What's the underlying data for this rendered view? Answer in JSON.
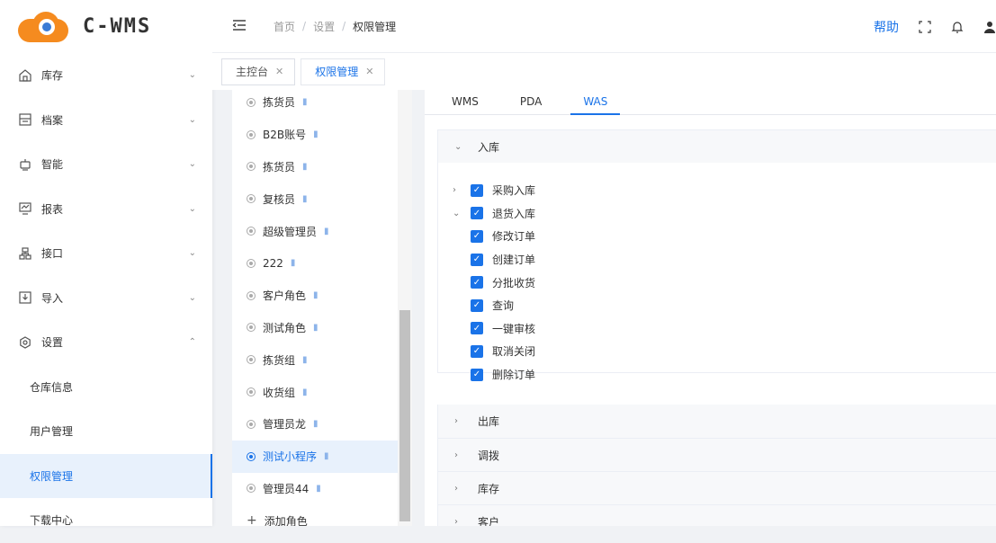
{
  "brand": {
    "logo_text": "C-WMS"
  },
  "sidebar": {
    "menu": [
      {
        "label": "库存",
        "icon": "home-icon",
        "arrow": "⌄"
      },
      {
        "label": "档案",
        "icon": "archive-icon",
        "arrow": "⌄"
      },
      {
        "label": "智能",
        "icon": "robot-icon",
        "arrow": "⌄"
      },
      {
        "label": "报表",
        "icon": "chart-icon",
        "arrow": "⌄"
      },
      {
        "label": "接口",
        "icon": "network-icon",
        "arrow": "⌄"
      },
      {
        "label": "导入",
        "icon": "import-icon",
        "arrow": "⌄"
      },
      {
        "label": "设置",
        "icon": "gear-icon",
        "arrow": "⌃"
      }
    ],
    "sub": [
      {
        "label": "仓库信息"
      },
      {
        "label": "用户管理"
      },
      {
        "label": "权限管理"
      },
      {
        "label": "下载中心"
      }
    ]
  },
  "header": {
    "breadcrumb": [
      "首页",
      "设置",
      "权限管理"
    ],
    "separator": "/",
    "help": "帮助",
    "accent": "#1a73e8"
  },
  "tags": [
    {
      "label": "主控台",
      "close": "✕"
    },
    {
      "label": "权限管理",
      "close": "✕"
    }
  ],
  "roles": {
    "items": [
      "拣货员",
      "B2B账号",
      "拣货员",
      "复核员",
      "超级管理员",
      "222",
      "客户角色",
      "测试角色",
      "拣货组",
      "收货组",
      "管理员龙",
      "测试小程序",
      "管理员44"
    ],
    "active_index": 11,
    "add_label": "添加角色",
    "add_symbol": "+",
    "delete_symbol": "▮"
  },
  "permissions": {
    "tabs": [
      "WMS",
      "PDA",
      "WAS"
    ],
    "active_tab": "WAS",
    "sections": {
      "inbound": {
        "title": "入库",
        "expanded_arrow": "⌄",
        "groups": [
          {
            "label": "采购入库",
            "arrow": "›",
            "checked": true
          },
          {
            "label": "退货入库",
            "arrow": "⌄",
            "checked": true
          }
        ],
        "children": [
          "修改订单",
          "创建订单",
          "分批收货",
          "查询",
          "一键审核",
          "取消关闭",
          "删除订单"
        ]
      },
      "collapsed": [
        {
          "title": "出库",
          "arrow": "›"
        },
        {
          "title": "调拨",
          "arrow": "›"
        },
        {
          "title": "库存",
          "arrow": "›"
        },
        {
          "title": "客户",
          "arrow": "›"
        }
      ]
    },
    "check_mark": "✓"
  }
}
